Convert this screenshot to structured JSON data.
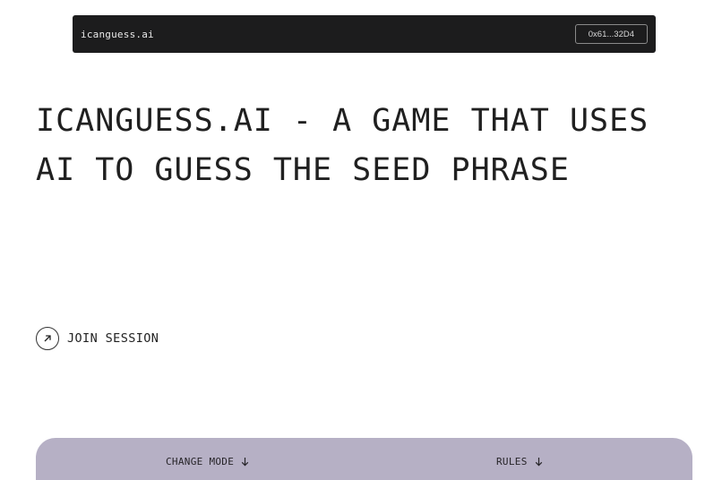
{
  "header": {
    "brand": "icanguess.ai",
    "wallet_address": "0x61...32D4"
  },
  "hero": {
    "title": "ICANGUESS.AI - A GAME THAT USES AI TO GUESS THE SEED PHRASE"
  },
  "actions": {
    "join_label": "JOIN SESSION",
    "join_icon": "arrow-up-right-icon"
  },
  "panel": {
    "change_mode_label": "CHANGE MODE",
    "rules_label": "RULES",
    "dropdown_icon": "arrow-down-icon"
  },
  "colors": {
    "topbar_bg": "#1c1c1d",
    "panel_bg": "#b6b0c5",
    "text": "#202020"
  }
}
